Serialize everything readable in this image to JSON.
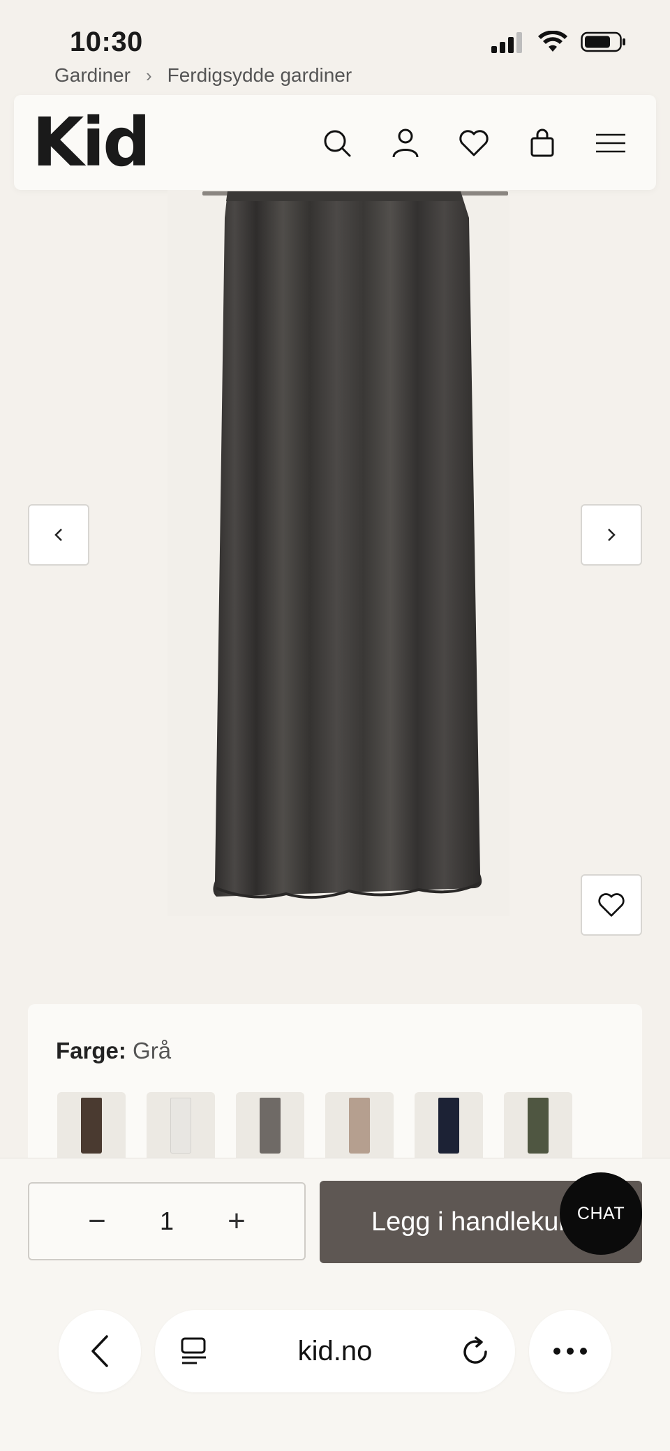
{
  "status_bar": {
    "time": "10:30"
  },
  "breadcrumb": {
    "items": [
      "Gardiner",
      "Ferdigsydde gardiner"
    ],
    "separator": "›"
  },
  "header": {
    "logo": "Kid",
    "icons": [
      "search-icon",
      "account-icon",
      "heart-icon",
      "bag-icon",
      "menu-icon"
    ]
  },
  "gallery": {
    "curtain_color": "#3f3d3b",
    "prev_icon": "‹",
    "next_icon": "›"
  },
  "options": {
    "color_label": "Farge:",
    "color_value": "Grå",
    "swatches": [
      {
        "name": "brown",
        "color": "#4a3a30"
      },
      {
        "name": "white",
        "color": "#e8e6e2"
      },
      {
        "name": "grey",
        "color": "#6f6a66"
      },
      {
        "name": "beige",
        "color": "#b59f8f"
      },
      {
        "name": "navy",
        "color": "#1c2235"
      },
      {
        "name": "olive",
        "color": "#4f5641"
      }
    ]
  },
  "purchase": {
    "quantity": "1",
    "minus": "−",
    "plus": "+",
    "add_to_cart": "Legg i handlekurv",
    "chat": "CHAT"
  },
  "browser": {
    "url": "kid.no"
  },
  "colors": {
    "button_dark": "#5e5753",
    "background": "#f4f1ec"
  }
}
